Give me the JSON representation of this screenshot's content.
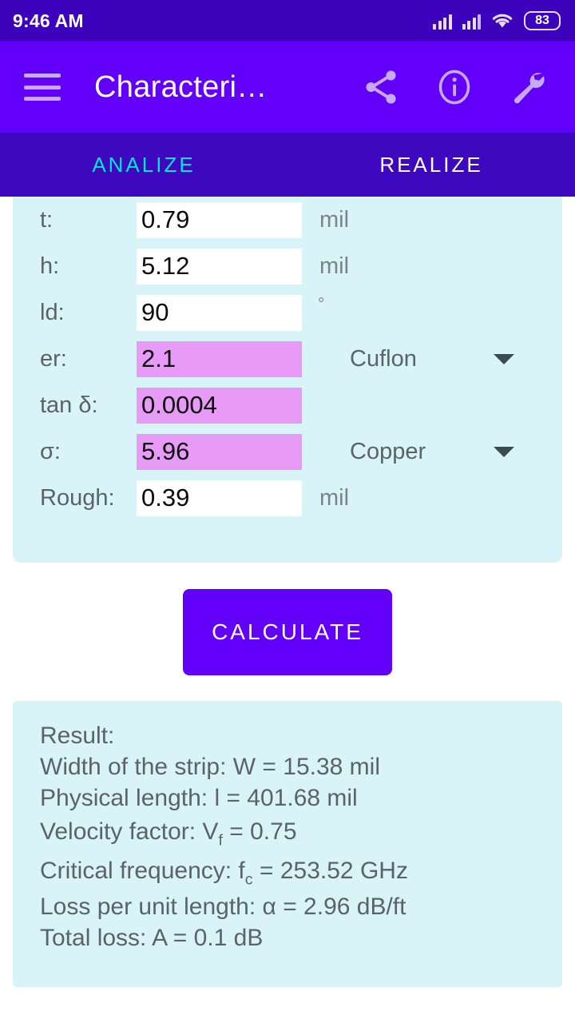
{
  "status_bar": {
    "time": "9:46 AM",
    "battery_percent": "83",
    "icons": [
      "signal-bars-icon",
      "signal-bars-icon",
      "wifi-icon",
      "battery-icon"
    ]
  },
  "app_bar": {
    "menu_icon": "hamburger-menu-icon",
    "title": "Characteri…",
    "actions": [
      {
        "name": "share-icon",
        "label": "Share"
      },
      {
        "name": "info-icon",
        "label": "Info"
      },
      {
        "name": "wrench-icon",
        "label": "Settings"
      }
    ]
  },
  "tabs": [
    {
      "label": "ANALIZE",
      "active": true
    },
    {
      "label": "REALIZE",
      "active": false
    }
  ],
  "form": {
    "rows": [
      {
        "label": "t:",
        "value": "0.79",
        "unit": "mil",
        "highlight": false
      },
      {
        "label": "h:",
        "value": "5.12",
        "unit": "mil",
        "highlight": false
      },
      {
        "label": "ld:",
        "value": "90",
        "unit": "°",
        "highlight": false
      },
      {
        "label": "er:",
        "value": "2.1",
        "unit": "",
        "highlight": true,
        "select": "Cuflon"
      },
      {
        "label": "tan δ:",
        "value": "0.0004",
        "unit": "",
        "highlight": true
      },
      {
        "label": "σ:",
        "value": "5.96",
        "unit": "",
        "highlight": true,
        "select": "Copper"
      },
      {
        "label": "Rough:",
        "value": "0.39",
        "unit": "mil",
        "highlight": false
      }
    ]
  },
  "calculate_button": {
    "label": "CALCULATE"
  },
  "result": {
    "heading": "Result:",
    "lines": [
      {
        "text": "Width of the strip: W = 15.38 mil"
      },
      {
        "text": "Physical length: l = 401.68 mil"
      },
      {
        "prefix": "Velocity factor: V",
        "sub": "f",
        "suffix": " = 0.75"
      },
      {
        "prefix": "Critical frequency: f",
        "sub": "c",
        "suffix": " = 253.52 GHz"
      },
      {
        "text": "Loss per unit length: α = 2.96 dB/ft"
      },
      {
        "text": "Total loss: A = 0.1 dB"
      }
    ]
  },
  "colors": {
    "status_bar": "#3D03BC",
    "app_bar": "#6200FA",
    "tab_bar": "#3D08BE",
    "tab_active": "#00E5DE",
    "card": "#D9F4F8",
    "field_highlight": "#E79BF7",
    "accent_button": "#6200FA",
    "text_muted": "#5C6366"
  }
}
